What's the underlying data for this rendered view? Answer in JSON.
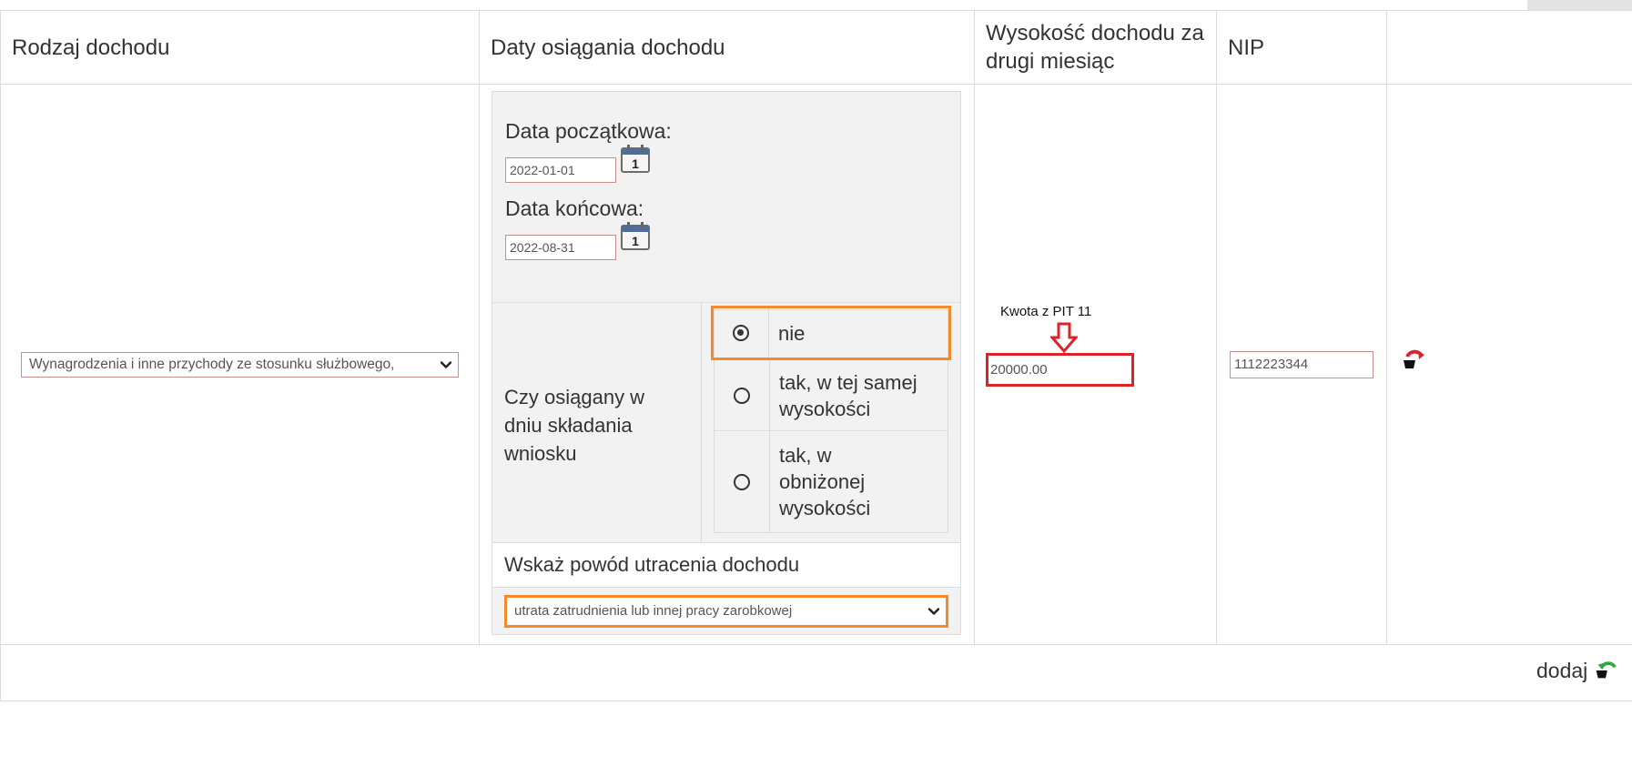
{
  "table": {
    "headers": {
      "income_type": "Rodzaj dochodu",
      "dates": "Daty osiągania dochodu",
      "amount_line1": "Wysokość dochodu za",
      "amount_line2": "drugi miesiąc",
      "nip": "NIP"
    },
    "row": {
      "income_type_value": "Wynagrodzenia i inne przychody ze stosunku służbowego,",
      "start_label": "Data początkowa:",
      "start_value": "2022-01-01",
      "end_label": "Data końcowa:",
      "end_value": "2022-08-31",
      "calendar_day": "1",
      "question_line1": "Czy osiągany w",
      "question_line2": "dniu składania",
      "question_line3": "wniosku",
      "options": [
        {
          "lines": [
            "nie"
          ],
          "checked": true
        },
        {
          "lines": [
            "tak, w tej samej",
            "wysokości"
          ],
          "checked": false
        },
        {
          "lines": [
            "tak, w",
            "obniżonej",
            "wysokości"
          ],
          "checked": false
        }
      ],
      "reason_label": "Wskaż powód utracenia dochodu",
      "reason_value": "utrata zatrudnienia lub innej pracy zarobkowej",
      "annotation": "Kwota z PIT 11",
      "amount_value": "20000.00",
      "nip_value": "1112223344"
    },
    "add_label": "dodaj"
  },
  "colors": {
    "highlight_orange": "#f28a2e",
    "highlight_red": "#d9242a",
    "input_border": "#c8908c",
    "panel_bg": "#f2f2f2"
  },
  "icons": [
    "calendar-icon",
    "radio-selected-icon",
    "radio-unselected-icon",
    "chevron-down-icon",
    "arrow-down-icon",
    "remove-row-icon",
    "add-row-icon"
  ]
}
